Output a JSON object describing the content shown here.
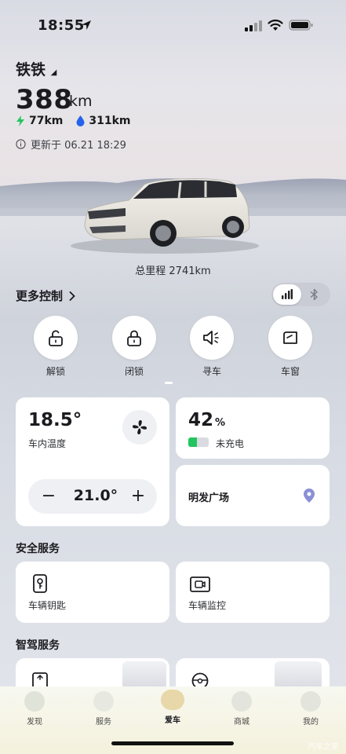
{
  "status_bar": {
    "time": "18:55"
  },
  "header": {
    "car_name": "铁铁",
    "range": "388",
    "range_unit": "km",
    "electric_range": "77km",
    "fuel_range": "311km",
    "updated": "更新于 06.21 18:29"
  },
  "scene": {
    "odometer": "总里程 2741km"
  },
  "controls": {
    "more_label": "更多控制",
    "buttons": [
      {
        "label": "解锁",
        "icon": "unlock-icon"
      },
      {
        "label": "闭锁",
        "icon": "lock-icon"
      },
      {
        "label": "寻车",
        "icon": "horn-icon"
      },
      {
        "label": "车窗",
        "icon": "window-icon"
      }
    ]
  },
  "climate": {
    "inner_temp": "18.5°",
    "inner_label": "车内温度",
    "set_temp": "21.0°",
    "minus": "−",
    "plus": "+"
  },
  "battery": {
    "percent": "42",
    "unit": "%",
    "status": "未充电",
    "level": 0.42
  },
  "location": {
    "place": "明发广场"
  },
  "safety": {
    "title": "安全服务",
    "items": [
      {
        "label": "车辆钥匙"
      },
      {
        "label": "车辆监控"
      }
    ]
  },
  "smart": {
    "title": "智驾服务"
  },
  "nav": {
    "items": [
      {
        "label": "发现"
      },
      {
        "label": "服务"
      },
      {
        "label": "爱车"
      },
      {
        "label": "商城"
      },
      {
        "label": "我的"
      }
    ]
  },
  "watermark": "汽车之家",
  "colors": {
    "accent_green": "#22c55e",
    "fuel_blue": "#2563eb",
    "location_purple": "#8b90d6"
  }
}
